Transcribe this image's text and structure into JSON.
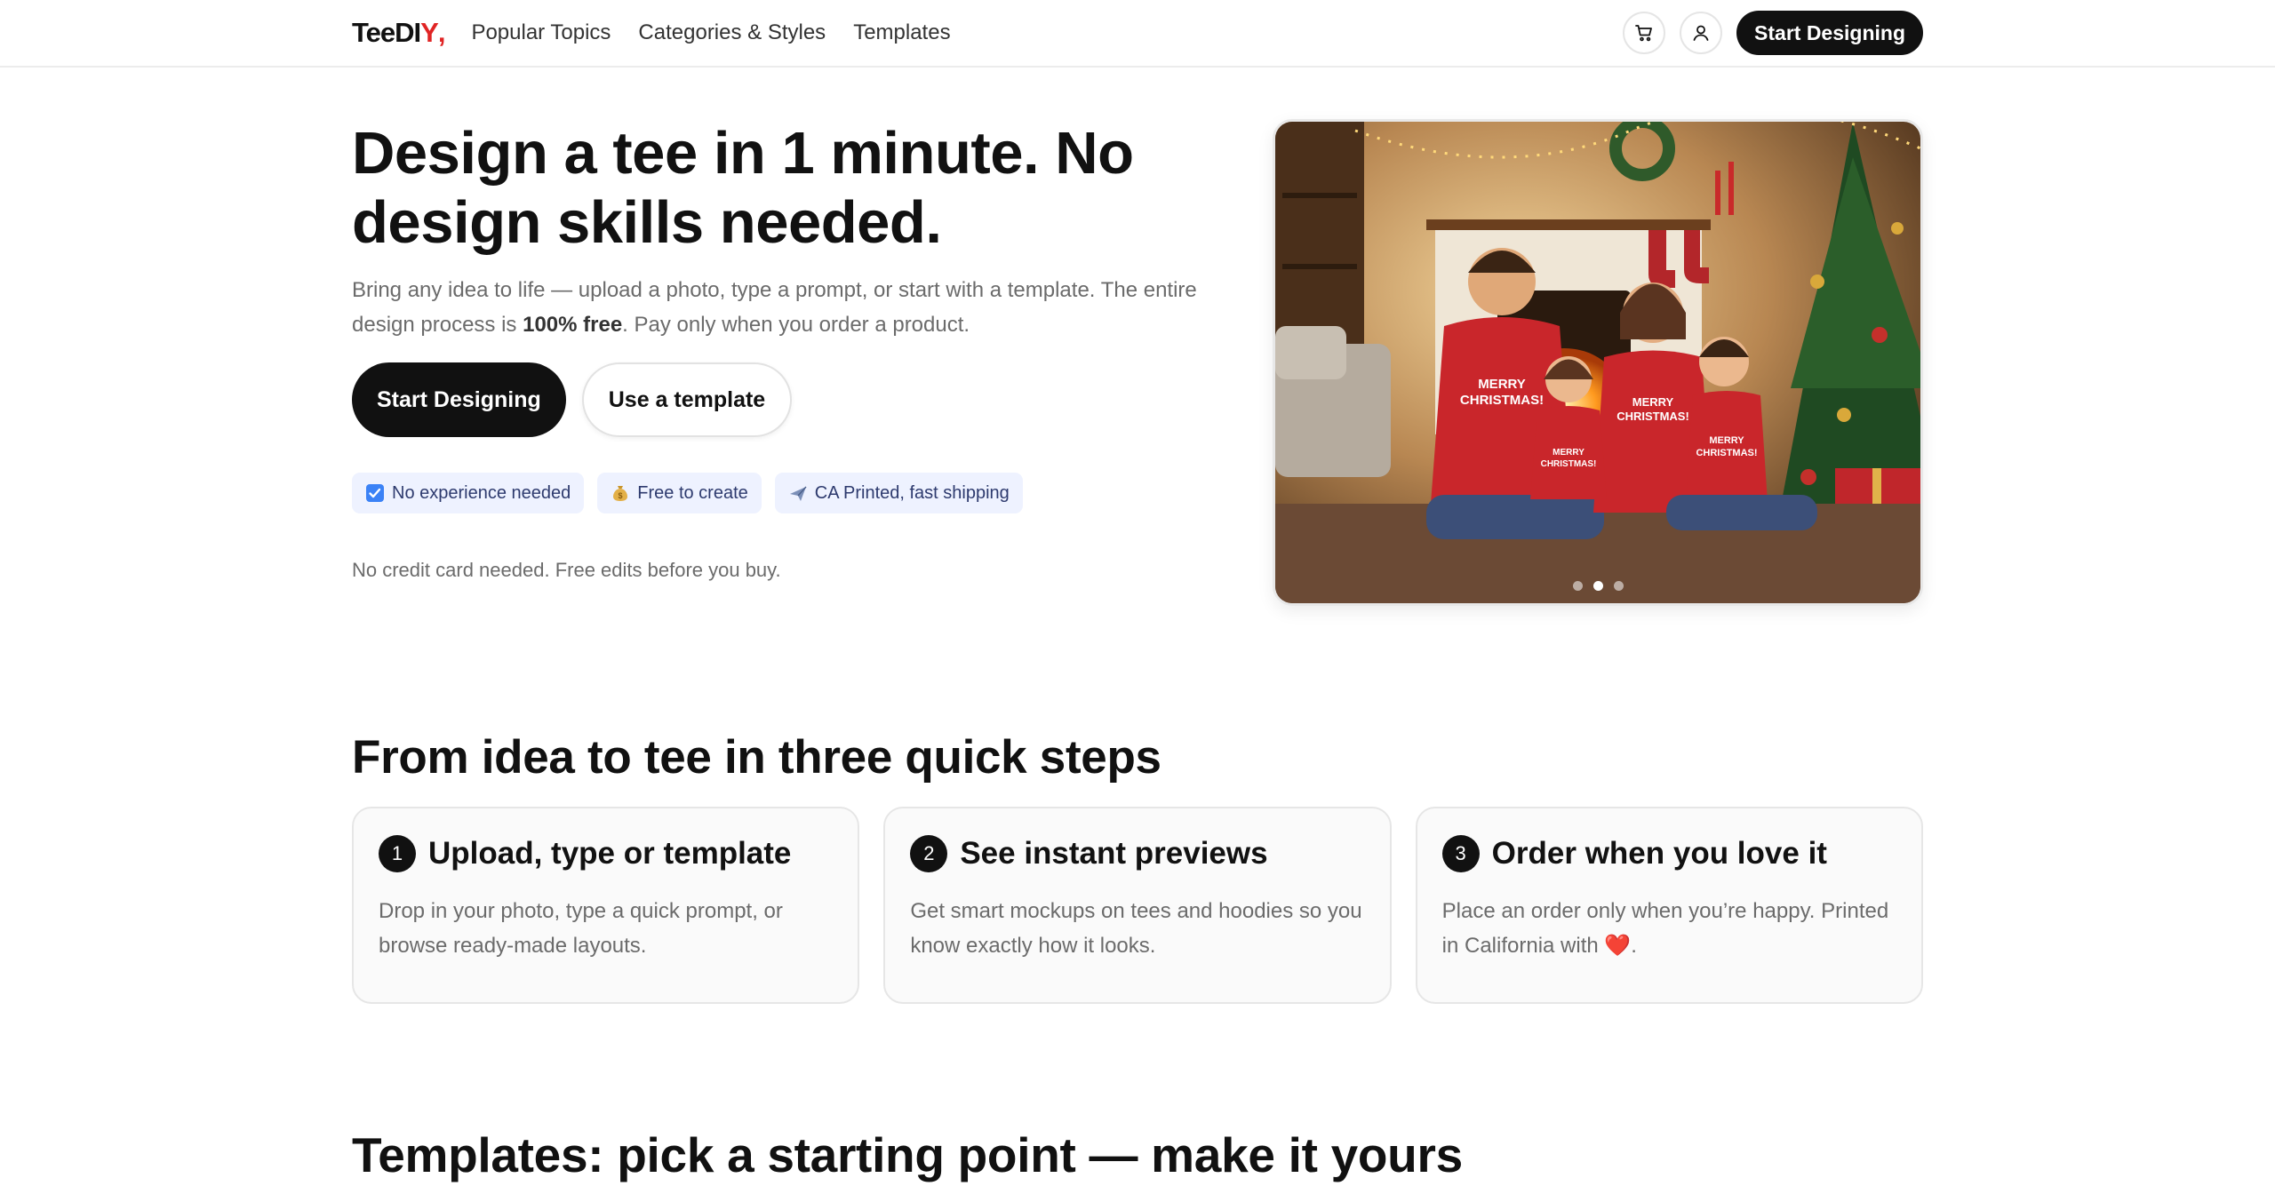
{
  "header": {
    "logo_main": "TeeDI",
    "logo_accent": "Y",
    "logo_tail": ",",
    "nav": [
      "Popular Topics",
      "Categories & Styles",
      "Templates"
    ],
    "cta": "Start Designing",
    "cart_icon": "cart-icon",
    "account_icon": "user-icon"
  },
  "hero": {
    "title": "Design a tee in 1 minute. No design skills needed.",
    "subtitle_before": "Bring any idea to life — upload a photo, type a prompt, or start with a template. The entire design process is ",
    "subtitle_bold": "100% free",
    "subtitle_after": ". Pay only when you order a product.",
    "primary_button": "Start Designing",
    "secondary_button": "Use a template",
    "badges": [
      {
        "icon": "check-box-icon",
        "label": "No experience needed"
      },
      {
        "icon": "money-bag-icon",
        "label": "Free to create"
      },
      {
        "icon": "airplane-icon",
        "label": "CA Printed, fast shipping"
      }
    ],
    "note": "No credit card needed. Free edits before you buy.",
    "carousel": {
      "slides": 3,
      "active": 2,
      "shirt_text_1": "MERRY",
      "shirt_text_2": "CHRISTMAS!"
    }
  },
  "steps": {
    "title": "From idea to tee in three quick steps",
    "items": [
      {
        "num": "1",
        "title": "Upload, type or template",
        "desc": "Drop in your photo, type a quick prompt, or browse ready-made layouts."
      },
      {
        "num": "2",
        "title": "See instant previews",
        "desc": "Get smart mockups on tees and hoodies so you know exactly how it looks."
      },
      {
        "num": "3",
        "title": "Order when you love it",
        "desc": "Place an order only when you’re happy. Printed in California with ❤️."
      }
    ]
  },
  "templates": {
    "title": "Templates: pick a starting point — make it yours"
  },
  "colors": {
    "accent": "#111111",
    "logo_red": "#e02424",
    "badge_bg": "#eef2ff",
    "muted_text": "#6b6b6b"
  }
}
